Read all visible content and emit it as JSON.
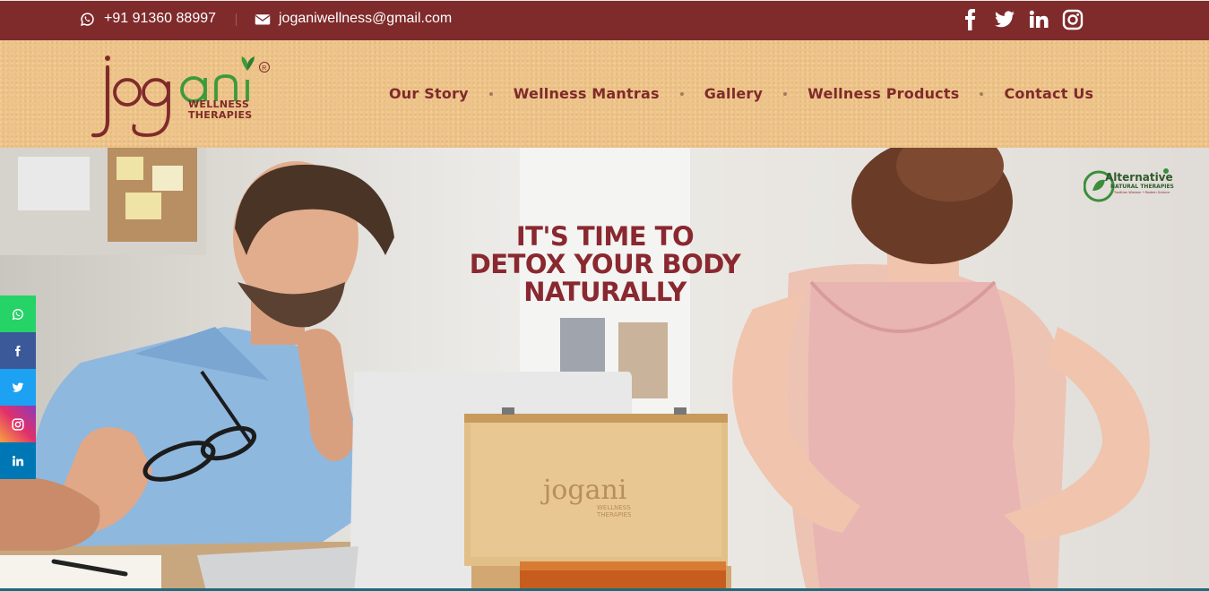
{
  "topbar": {
    "phone": "+91 91360 88997",
    "email": "joganiwellness@gmail.com",
    "social_icons": [
      "facebook-icon",
      "twitter-icon",
      "linkedin-icon",
      "instagram-icon"
    ]
  },
  "logo": {
    "brand": "jogani",
    "tagline_line1": "WELLNESS",
    "tagline_line2": "THERAPIES",
    "registered": "®"
  },
  "nav": {
    "items": [
      {
        "label": "Our Story"
      },
      {
        "label": "Wellness Mantras"
      },
      {
        "label": "Gallery"
      },
      {
        "label": "Wellness Products"
      },
      {
        "label": "Contact Us"
      }
    ]
  },
  "hero": {
    "title_line1": "IT'S TIME TO",
    "title_line2": "DETOX YOUR BODY",
    "title_line3": "NATURALLY",
    "box_brand": "jogani",
    "box_tagline1": "WELLNESS",
    "box_tagline2": "THERAPIES",
    "badge_line1": "Alternative",
    "badge_line2": "NATURAL THERAPIES",
    "badge_line3": "Tradition Wisdom • Modern Science"
  },
  "floatbar": {
    "icons": [
      "whatsapp-icon",
      "facebook-icon",
      "twitter-icon",
      "instagram-icon",
      "linkedin-icon"
    ]
  },
  "colors": {
    "brand_maroon": "#7f2a2b",
    "header_tan": "#eec48a",
    "logo_green": "#3c9a3a"
  }
}
